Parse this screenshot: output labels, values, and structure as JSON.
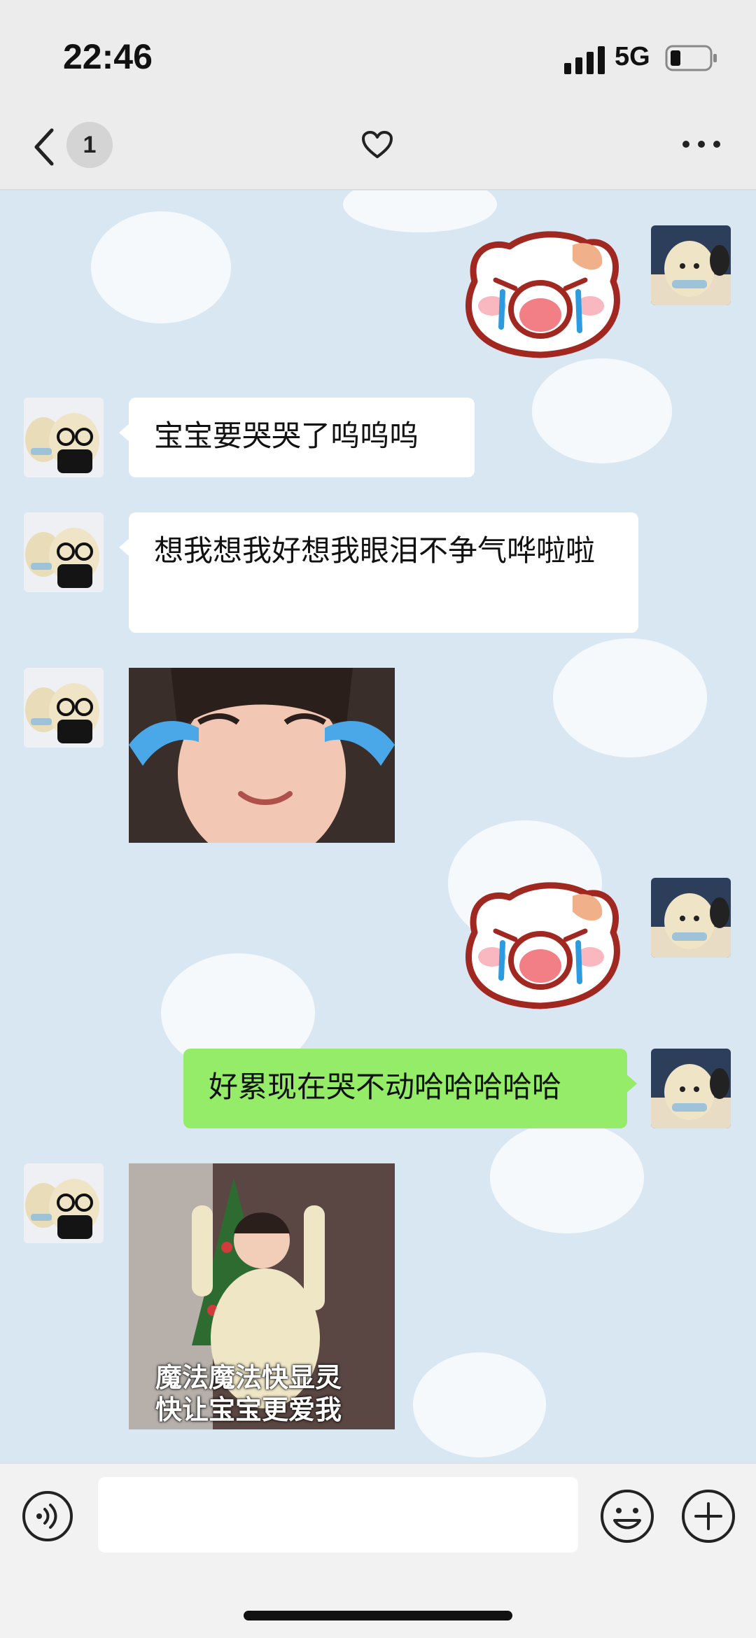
{
  "status": {
    "time": "22:46",
    "network": "5G"
  },
  "nav": {
    "badge": "1"
  },
  "messages": [
    {
      "type": "sticker",
      "side": "right",
      "name": "crying-cat"
    },
    {
      "type": "text",
      "side": "left",
      "text": "宝宝要哭哭了呜呜呜"
    },
    {
      "type": "text",
      "side": "left",
      "text": "想我想我好想我眼泪不争气哗啦啦"
    },
    {
      "type": "image",
      "side": "left",
      "name": "crying-girl"
    },
    {
      "type": "sticker",
      "side": "right",
      "name": "crying-cat"
    },
    {
      "type": "text",
      "side": "right",
      "text": "好累现在哭不动哈哈哈哈哈"
    },
    {
      "type": "image",
      "side": "left",
      "name": "girl-with-tree",
      "caption_line1": "魔法魔法快显灵",
      "caption_line2": "快让宝宝更爱我"
    }
  ],
  "input": {
    "value": "",
    "placeholder": ""
  },
  "colors": {
    "outgoing_bubble": "#95ec69",
    "incoming_bubble": "#ffffff",
    "chat_bg": "#d9e7f3",
    "cat_outline": "#a02820"
  }
}
